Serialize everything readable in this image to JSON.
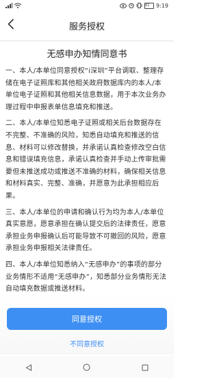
{
  "status_bar": {
    "left_icons": [
      "signal-icon",
      "wifi-icon"
    ],
    "right_icons": [
      "eye-icon",
      "alarm-icon",
      "vibrate-icon"
    ],
    "battery_level": "82",
    "time": "9:19"
  },
  "header": {
    "back_icon": "chevron-left-icon",
    "title": "服务授权"
  },
  "document": {
    "title": "无感申办知情同意书",
    "paragraphs": [
      "一、本人/本单位同意授权“i深圳”平台调取、整理存储在电子证照库和其他相关政府数据库内的本人/本单位电子证照和其他相关信息数据，用于本次业务办理过程中申报表单信息填充和推送。",
      "二、本人/本单位知悉电子证照或相关后台数据存在不完整、不准确的风险，知悉自动填充和推送的信息、材料可以修改替换，并承诺认真检查修改空白信息和错误填充信息，承诺认真检查并手动上传审批需要但未推送成功或推送不准确的材料，确保相关信息和材料真实、完整、准确，并愿意为此承担相应后果。",
      "三、本人/本单位的申请和确认行为均为本人/本单位真实意愿，愿意承担在确认提交后的法律责任，愿意承担业务申报确认后可能导致不可撤回的风险，愿意承担业务申报相关法律责任。",
      "四、本人/本单位知悉纳入“无感申办”的事项的部分业务情形不适用“无感申办”，知悉部分业务情形无法自动填充数据或推送材料。"
    ]
  },
  "actions": {
    "agree_label": "同意授权",
    "disagree_label": "不同意授权"
  },
  "nav": {
    "back_icon": "triangle-back-icon",
    "home_icon": "circle-home-icon",
    "recent_icon": "square-recent-icon"
  },
  "colors": {
    "accent": "#3d8ff3",
    "text": "#333333",
    "background": "#ffffff"
  }
}
